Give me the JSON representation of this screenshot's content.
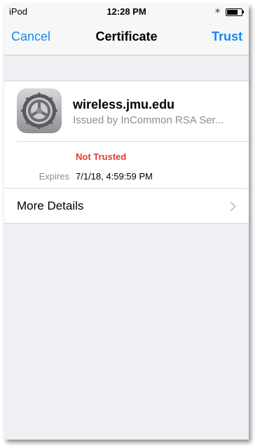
{
  "status_bar": {
    "carrier": "iPod",
    "time": "12:28 PM",
    "battery_level": 0.75
  },
  "nav": {
    "cancel_label": "Cancel",
    "title": "Certificate",
    "trust_label": "Trust"
  },
  "certificate": {
    "icon": "settings-gear-icon",
    "name": "wireless.jmu.edu",
    "issuer": "Issued by InCommon RSA Ser...",
    "trust_status": "Not Trusted",
    "expires_label": "Expires",
    "expires_value": "7/1/18, 4:59:59 PM"
  },
  "more_details": {
    "label": "More Details"
  },
  "colors": {
    "accent": "#1a86f0",
    "not_trusted": "#e53a30",
    "secondary_text": "#8e8e93",
    "grouped_background": "#efeff4"
  }
}
